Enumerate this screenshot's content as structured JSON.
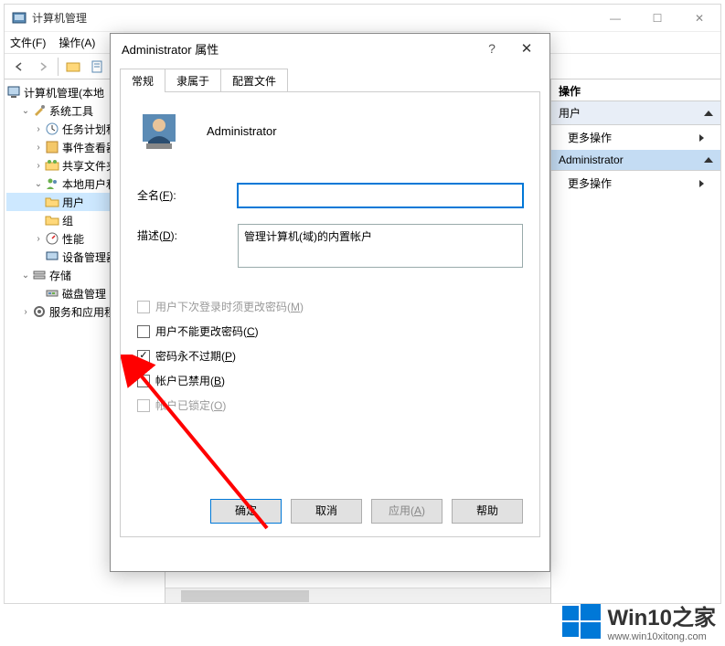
{
  "window": {
    "title": "计算机管理",
    "menu": {
      "file": "文件(F)",
      "action": "操作(A)"
    }
  },
  "tree": {
    "root": "计算机管理(本地",
    "systools": "系统工具",
    "task": "任务计划科",
    "event": "事件查看器",
    "share": "共享文件夹",
    "localusers": "本地用户和",
    "users": "用户",
    "groups": "组",
    "perf": "性能",
    "devmgr": "设备管理器",
    "storage": "存储",
    "diskmgr": "磁盘管理",
    "services": "服务和应用程"
  },
  "actions": {
    "header": "操作",
    "section_users": "用户",
    "more": "更多操作",
    "section_admin": "Administrator"
  },
  "dialog": {
    "title": "Administrator 属性",
    "tabs": {
      "general": "常规",
      "memberof": "隶属于",
      "profile": "配置文件"
    },
    "username": "Administrator",
    "fullname_label": "全名(F):",
    "fullname_value": "",
    "desc_label": "描述(D):",
    "desc_value": "管理计算机(域)的内置帐户",
    "cb_mustchange": "用户下次登录时须更改密码(M)",
    "cb_cannotchange": "用户不能更改密码(C)",
    "cb_neverexpire": "密码永不过期(P)",
    "cb_disabled": "帐户已禁用(B)",
    "cb_locked": "帐户已锁定(O)",
    "buttons": {
      "ok": "确定",
      "cancel": "取消",
      "apply": "应用(A)",
      "help": "帮助"
    }
  },
  "watermark": {
    "big": "Win10之家",
    "url": "www.win10xitong.com"
  }
}
